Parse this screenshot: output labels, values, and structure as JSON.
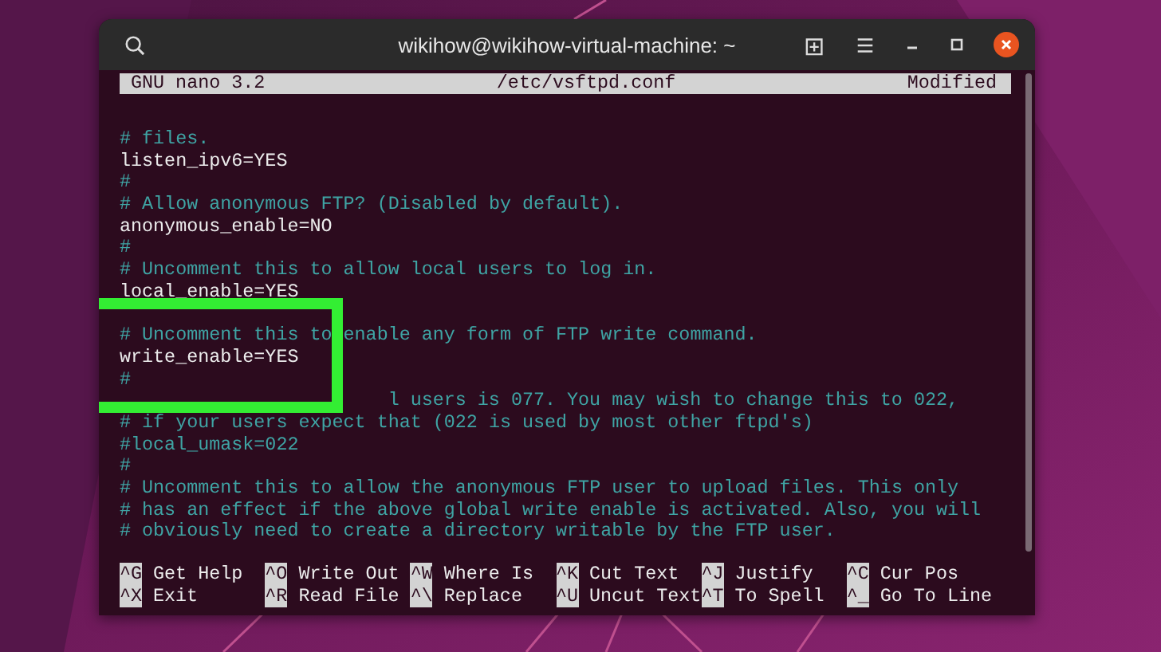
{
  "window": {
    "title": "wikihow@wikihow-virtual-machine: ~"
  },
  "nano_header": {
    "app": "GNU nano 3.2",
    "file": "/etc/vsftpd.conf",
    "status": "Modified"
  },
  "lines": [
    {
      "kind": "comment",
      "text": "# files."
    },
    {
      "kind": "setting",
      "text": "listen_ipv6=YES"
    },
    {
      "kind": "comment",
      "text": "#"
    },
    {
      "kind": "comment",
      "text": "# Allow anonymous FTP? (Disabled by default)."
    },
    {
      "kind": "setting",
      "text": "anonymous_enable=NO"
    },
    {
      "kind": "comment",
      "text": "#"
    },
    {
      "kind": "comment",
      "text": "# Uncomment this to allow local users to log in."
    },
    {
      "kind": "setting",
      "text": "local_enable=YES"
    },
    {
      "kind": "blank"
    },
    {
      "kind": "comment",
      "text": "# Uncomment this to enable any form of FTP write command."
    },
    {
      "kind": "setting",
      "text": "write_enable=YES",
      "highlighted": true
    },
    {
      "kind": "comment",
      "text": "#"
    },
    {
      "kind": "partial",
      "text": "l users is 077. You may wish to change this to 022,"
    },
    {
      "kind": "comment",
      "text": "# if your users expect that (022 is used by most other ftpd's)"
    },
    {
      "kind": "comment",
      "text": "#local_umask=022"
    },
    {
      "kind": "comment",
      "text": "#"
    },
    {
      "kind": "comment",
      "text": "# Uncomment this to allow the anonymous FTP user to upload files. This only"
    },
    {
      "kind": "comment",
      "text": "# has an effect if the above global write enable is activated. Also, you will"
    },
    {
      "kind": "comment",
      "text": "# obviously need to create a directory writable by the FTP user."
    }
  ],
  "shortcuts": [
    {
      "key": "^G",
      "label": "Get Help"
    },
    {
      "key": "^O",
      "label": "Write Out"
    },
    {
      "key": "^W",
      "label": "Where Is"
    },
    {
      "key": "^K",
      "label": "Cut Text"
    },
    {
      "key": "^J",
      "label": "Justify"
    },
    {
      "key": "^C",
      "label": "Cur Pos"
    },
    {
      "key": "^X",
      "label": "Exit"
    },
    {
      "key": "^R",
      "label": "Read File"
    },
    {
      "key": "^\\",
      "label": "Replace"
    },
    {
      "key": "^U",
      "label": "Uncut Text"
    },
    {
      "key": "^T",
      "label": "To Spell"
    },
    {
      "key": "^_",
      "label": "Go To Line"
    }
  ]
}
